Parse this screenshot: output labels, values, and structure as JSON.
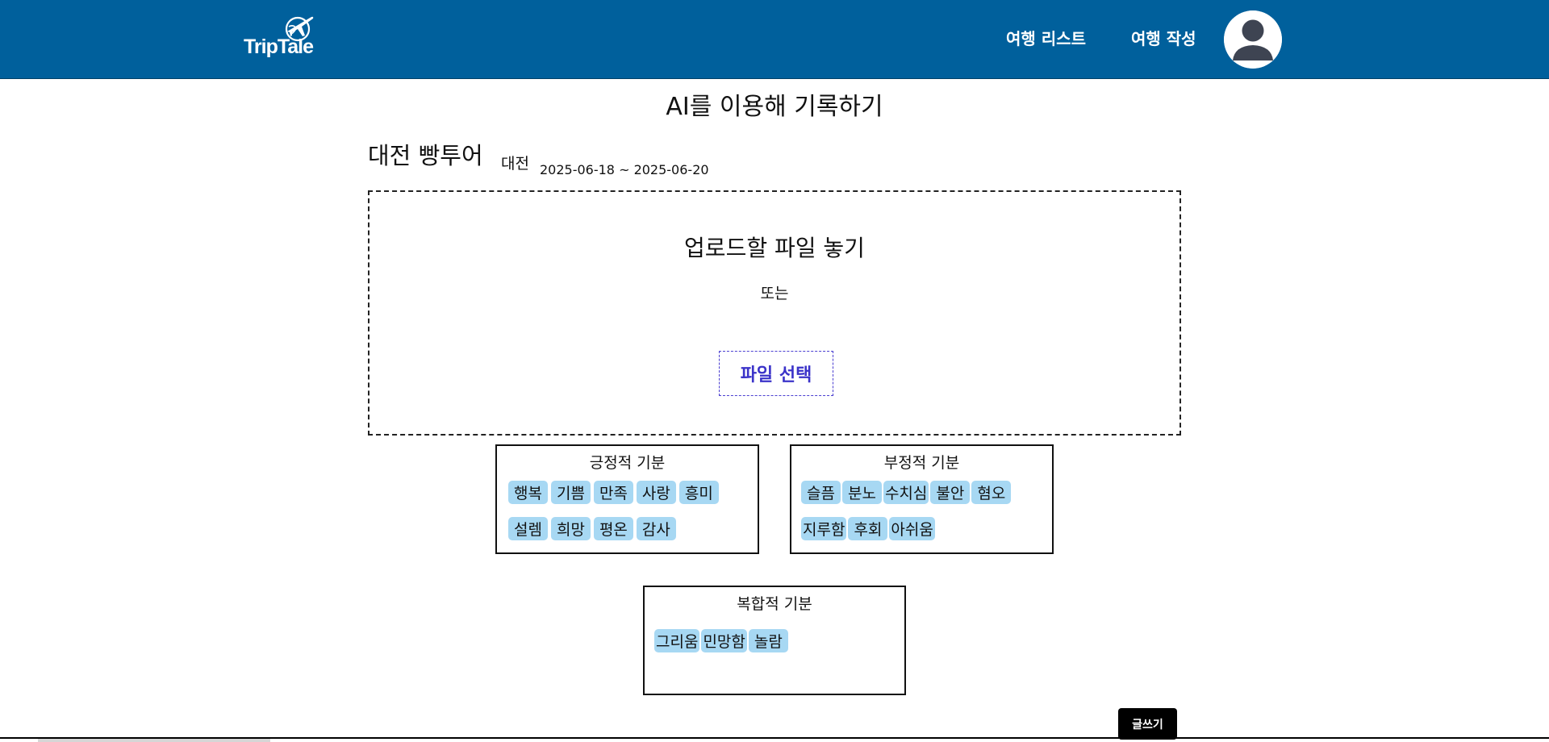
{
  "header": {
    "logo_text": "TripTale",
    "nav": [
      {
        "label": "여행 리스트"
      },
      {
        "label": "여행 작성"
      }
    ],
    "avatar_icon": "user-avatar-icon"
  },
  "page": {
    "title": "AI를 이용해 기록하기"
  },
  "trip": {
    "title": "대전 빵투어",
    "region": "대전",
    "dates": "2025-06-18 ~ 2025-06-20"
  },
  "upload": {
    "title": "업로드할 파일 놓기",
    "or": "또는",
    "button_label": "파일 선택"
  },
  "moods": {
    "positive": {
      "title": "긍정적 기분",
      "items": [
        "행복",
        "기쁨",
        "만족",
        "사랑",
        "흥미",
        "설렘",
        "희망",
        "평온",
        "감사"
      ]
    },
    "negative": {
      "title": "부정적 기분",
      "items": [
        "슬픔",
        "분노",
        "수치심",
        "불안",
        "혐오",
        "지루함",
        "후회",
        "아쉬움"
      ]
    },
    "complex": {
      "title": "복합적 기분",
      "items": [
        "그리움",
        "민망함",
        "놀람"
      ]
    }
  },
  "actions": {
    "submit_label": "글쓰기"
  },
  "colors": {
    "header_bg": "#00609c",
    "chip_bg": "#a7d8f3",
    "file_button": "#3b33c9"
  }
}
